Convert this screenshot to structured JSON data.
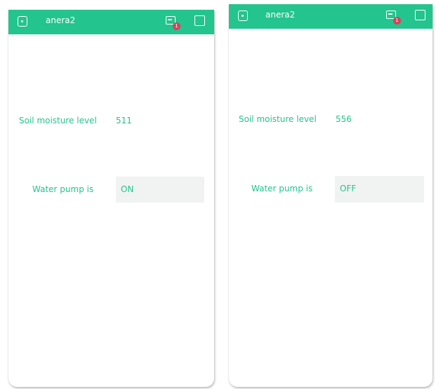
{
  "colors": {
    "accent": "#23c48e",
    "badge": "#d3435c",
    "value_box_bg": "#f1f2f2"
  },
  "screens": [
    {
      "header": {
        "title": "anera2",
        "notification_count": "1",
        "icons": [
          "app-icon",
          "device-icon",
          "square-icon"
        ]
      },
      "soil_moisture": {
        "label": "Soil moisture level",
        "value": "511"
      },
      "water_pump": {
        "label": "Water pump is",
        "value": "ON"
      }
    },
    {
      "header": {
        "title": "anera2",
        "notification_count": "1",
        "icons": [
          "app-icon",
          "device-icon",
          "square-icon"
        ]
      },
      "soil_moisture": {
        "label": "Soil moisture level",
        "value": "556"
      },
      "water_pump": {
        "label": "Water pump is",
        "value": "OFF"
      }
    }
  ]
}
